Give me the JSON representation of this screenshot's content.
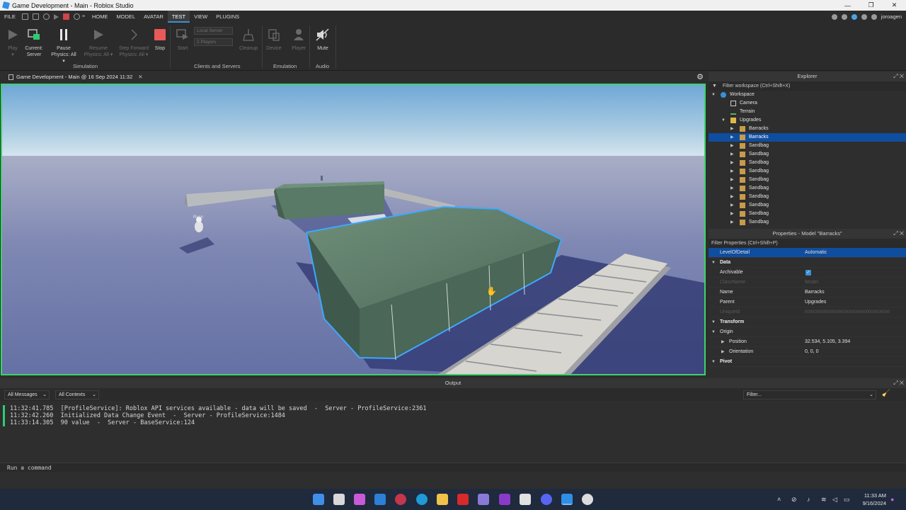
{
  "window": {
    "title": "Game Development - Main - Roblox Studio"
  },
  "menu": {
    "items": [
      "FILE",
      "HOME",
      "MODEL",
      "AVATAR",
      "TEST",
      "VIEW",
      "PLUGINS"
    ],
    "active": "TEST",
    "user": "joroagen"
  },
  "ribbon": {
    "play": {
      "label": "Play",
      "sub": "▾"
    },
    "current": {
      "label": "Current:",
      "sub": "Server"
    },
    "pause": {
      "label": "Pause",
      "sub": "Physics: All ▾"
    },
    "resume": {
      "label": "Resume",
      "sub": "Physics: All ▾"
    },
    "step": {
      "label": "Step Forward",
      "sub": "Physics: All ▾"
    },
    "stop": {
      "label": "Stop"
    },
    "start": {
      "label": "Start"
    },
    "server_select": "Local Server",
    "players_select": "2 Players",
    "cleanup": {
      "label": "Cleanup"
    },
    "device": {
      "label": "Device"
    },
    "player": {
      "label": "Player"
    },
    "mute": {
      "label": "Mute"
    },
    "groups": {
      "simulation": "Simulation",
      "clients": "Clients and Servers",
      "emulation": "Emulation",
      "audio": "Audio"
    }
  },
  "document_tab": {
    "label": "Game Development - Main @ 16 Sep 2024 11:32"
  },
  "viewport": {
    "player_name": "Ryan"
  },
  "explorer": {
    "title": "Explorer",
    "filter": "Filter workspace (Ctrl+Shift+X)",
    "items": [
      {
        "label": "Workspace"
      },
      {
        "label": "Camera"
      },
      {
        "label": "Terrain"
      },
      {
        "label": "Upgrades"
      },
      {
        "label": "Barracks"
      },
      {
        "label": "Barracks"
      },
      {
        "label": "Sandbag"
      },
      {
        "label": "Sandbag"
      },
      {
        "label": "Sandbag"
      },
      {
        "label": "Sandbag"
      },
      {
        "label": "Sandbag"
      },
      {
        "label": "Sandbag"
      },
      {
        "label": "Sandbag"
      },
      {
        "label": "Sandbag"
      },
      {
        "label": "Sandbag"
      },
      {
        "label": "Sandbag"
      }
    ]
  },
  "properties": {
    "title": "Properties - Model \"Barracks\"",
    "filter": "Filter Properties (Ctrl+Shift+P)",
    "rows": [
      {
        "key": "LevelOfDetail",
        "value": "Automatic"
      },
      {
        "key": "Data",
        "value": ""
      },
      {
        "key": "Archivable",
        "value": "✓"
      },
      {
        "key": "ClassName",
        "value": "Model"
      },
      {
        "key": "Name",
        "value": "Barracks"
      },
      {
        "key": "Parent",
        "value": "Upgrades"
      },
      {
        "key": "UniqueId",
        "value": "000000000000000000000000000000000000"
      },
      {
        "key": "Transform",
        "value": ""
      },
      {
        "key": "Origin",
        "value": ""
      },
      {
        "key": "Position",
        "value": "32.534, 5.105, 3.394"
      },
      {
        "key": "Orientation",
        "value": "0, 0, 0"
      },
      {
        "key": "Pivot",
        "value": ""
      }
    ]
  },
  "output": {
    "title": "Output",
    "messages_filter": "All Messages",
    "contexts_filter": "All Contexts",
    "search_placeholder": "Filter...",
    "lines": [
      "11:32:41.785  [ProfileService]: Roblox API services available - data will be saved  -  Server - ProfileService:2361",
      "11:32:42.260  Initialized Data Change Event  -  Server - ProfileService:1484",
      "11:33:14.305  90 value  -  Server - BaseService:124"
    ]
  },
  "command_bar": {
    "placeholder": "Run a command"
  },
  "taskbar": {
    "time": "11:33 AM",
    "date": "9/16/2024"
  },
  "colors": {
    "accent": "#0f4d9e",
    "play_border": "#3bd46a",
    "stop": "#e85a5a",
    "selection": "#3ea8ff"
  }
}
